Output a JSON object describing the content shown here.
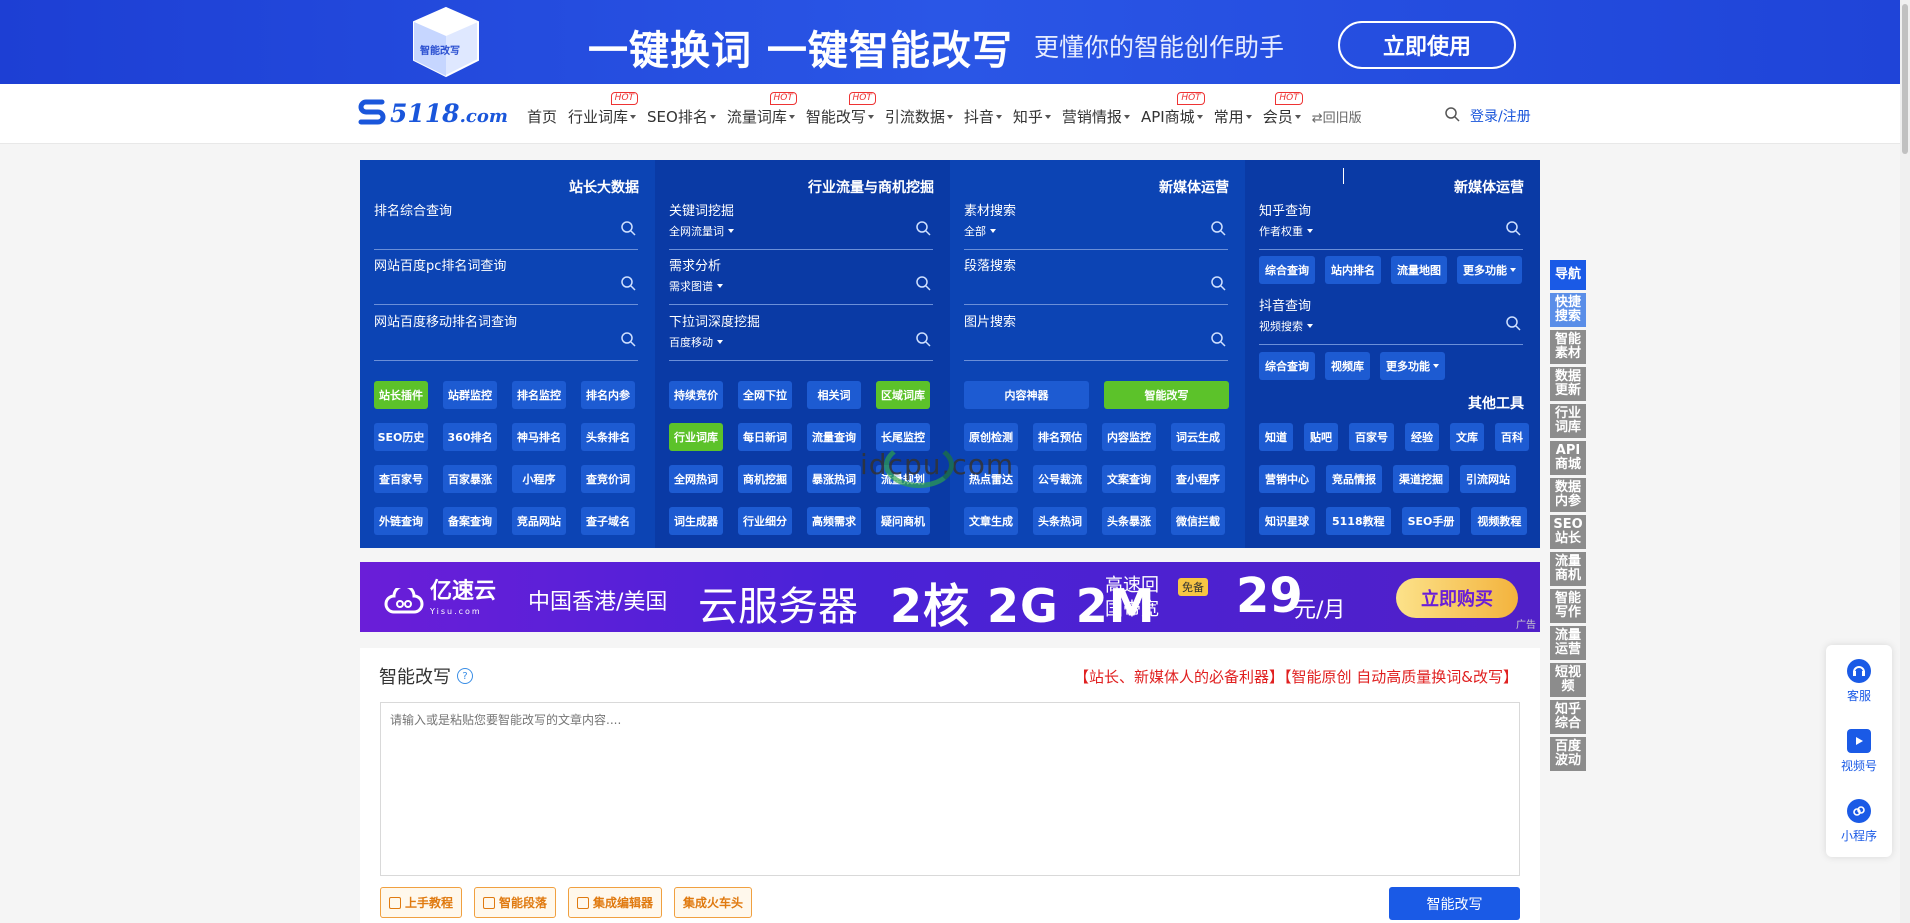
{
  "top_banner": {
    "headline": "一键换词 一键智能改写",
    "subtitle": "更懂你的智能创作助手",
    "cta": "立即使用",
    "cube_text": "智能改写"
  },
  "nav": {
    "logo_num": "5118",
    "logo_dom": ".com",
    "items": [
      {
        "label": "首页",
        "caret": false,
        "hot": false
      },
      {
        "label": "行业词库",
        "caret": true,
        "hot": true
      },
      {
        "label": "SEO排名",
        "caret": true,
        "hot": false
      },
      {
        "label": "流量词库",
        "caret": true,
        "hot": true
      },
      {
        "label": "智能改写",
        "caret": true,
        "hot": true
      },
      {
        "label": "引流数据",
        "caret": true,
        "hot": false
      },
      {
        "label": "抖音",
        "caret": true,
        "hot": false
      },
      {
        "label": "知乎",
        "caret": true,
        "hot": false
      },
      {
        "label": "营销情报",
        "caret": true,
        "hot": false
      },
      {
        "label": "API商城",
        "caret": true,
        "hot": true
      },
      {
        "label": "常用",
        "caret": true,
        "hot": false
      },
      {
        "label": "会员",
        "caret": true,
        "hot": true
      }
    ],
    "hot_label": "HOT",
    "old_version": "⇄回旧版",
    "login": "登录/注册"
  },
  "panel": {
    "col1": {
      "title": "站长大数据",
      "fields": [
        {
          "label": "排名综合查询",
          "select": ""
        },
        {
          "label": "网站百度pc排名词查询",
          "select": ""
        },
        {
          "label": "网站百度移动排名词查询",
          "select": ""
        }
      ],
      "buttons": [
        "站长插件",
        "站群监控",
        "排名监控",
        "排名内参",
        "SEO历史",
        "360排名",
        "神马排名",
        "头条排名",
        "查百家号",
        "百家暴涨",
        "小程序",
        "查竞价词",
        "外链查询",
        "备案查询",
        "竞品网站",
        "查子域名"
      ]
    },
    "col2": {
      "title": "行业流量与商机挖掘",
      "fields": [
        {
          "label": "关键词挖掘",
          "select": "全网流量词"
        },
        {
          "label": "需求分析",
          "select": "需求图谱"
        },
        {
          "label": "下拉词深度挖掘",
          "select": "百度移动"
        }
      ],
      "buttons": [
        "持续竞价",
        "全网下拉",
        "相关词",
        "区域词库",
        "行业词库",
        "每日新词",
        "流量查询",
        "长尾监控",
        "全网热词",
        "商机挖掘",
        "暴涨热词",
        "流量规划",
        "词生成器",
        "行业细分",
        "高频需求",
        "疑问商机"
      ]
    },
    "col3": {
      "title": "新媒体运营",
      "fields": [
        {
          "label": "素材搜索",
          "select": "全部"
        },
        {
          "label": "段落搜索",
          "select": ""
        },
        {
          "label": "图片搜索",
          "select": ""
        }
      ],
      "wide_buttons": [
        "内容神器",
        "智能改写"
      ],
      "buttons": [
        "原创检测",
        "排名预估",
        "内容监控",
        "词云生成",
        "热点雷达",
        "公号裁流",
        "文案查询",
        "查小程序",
        "文章生成",
        "头条热词",
        "头条暴涨",
        "微信拦截"
      ]
    },
    "col4": {
      "title": "新媒体运营",
      "fields": [
        {
          "label": "知乎查询",
          "select": "作者权重"
        },
        {
          "label": "抖音查询",
          "select": "视频搜索"
        }
      ],
      "zhihu_links": [
        "综合查询",
        "站内排名",
        "流量地图",
        "更多功能"
      ],
      "douyin_links": [
        "综合查询",
        "视频库",
        "更多功能"
      ],
      "other_title": "其他工具",
      "other_row1": [
        "知道",
        "贴吧",
        "百家号",
        "经验",
        "文库",
        "百科"
      ],
      "other_row2": [
        "营销中心",
        "竞品情报",
        "渠道挖掘",
        "引流网站"
      ],
      "other_row3": [
        "知识星球",
        "5118教程",
        "SEO手册",
        "视频教程"
      ]
    }
  },
  "watermark": "idcpu.com",
  "ad": {
    "brand": "亿速云",
    "brand_en": "Yisu.com",
    "region": "中国香港/美国",
    "product": "云服务器",
    "spec": "2核 2G 2M",
    "line1": "高速回",
    "line2": "国带宽",
    "free": "免备",
    "price": "29",
    "unit": "元/月",
    "buy": "立即购买",
    "tag": "广告"
  },
  "rewrite": {
    "title": "智能改写",
    "slogan": "【站长、新媒体人的必备利器】【智能原创 自动高质量换词&改写】",
    "placeholder": "请输入或是粘贴您要智能改写的文章内容....",
    "options": [
      "上手教程",
      "智能段落",
      "集成编辑器",
      "集成火车头"
    ],
    "submit": "智能改写"
  },
  "side_nav": [
    "导航",
    "快捷搜索",
    "智能素材",
    "数据更新",
    "行业词库",
    "API商城",
    "数据内参",
    "SEO站长",
    "流量商机",
    "智能写作",
    "流量运营",
    "短视频",
    "知乎综合",
    "百度波动"
  ],
  "float": [
    "客服",
    "视频号",
    "小程序"
  ],
  "colors": {
    "brand_blue": "#1a5ae6",
    "panel_blue": "#0c44b4",
    "green": "#5cc22a",
    "hot_red": "#e33333"
  }
}
